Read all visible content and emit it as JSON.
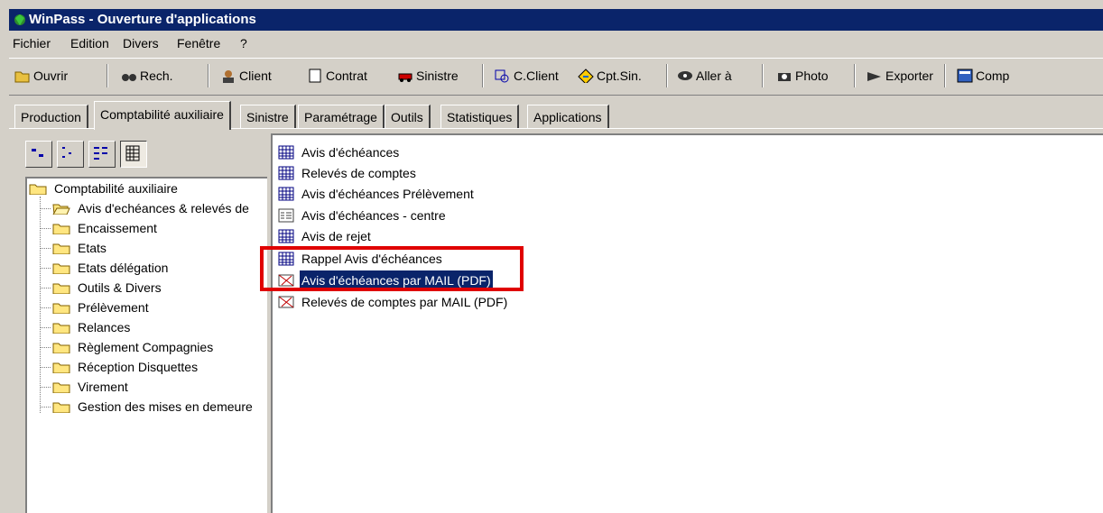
{
  "window": {
    "title": "WinPass - Ouverture d'applications"
  },
  "menu": [
    {
      "label": "Fichier"
    },
    {
      "label": "Edition"
    },
    {
      "label": "Divers"
    },
    {
      "label": "Fenêtre"
    },
    {
      "label": "?"
    }
  ],
  "toolbar": {
    "items": [
      {
        "label": "Ouvrir",
        "icon": "folder-open-icon"
      },
      {
        "label": "Rech.",
        "icon": "binoculars-icon"
      },
      {
        "label": "Client",
        "icon": "client-icon"
      },
      {
        "label": "Contrat",
        "icon": "document-icon"
      },
      {
        "label": "Sinistre",
        "icon": "car-crash-icon"
      },
      {
        "label": "C.Client",
        "icon": "search-client-icon"
      },
      {
        "label": "Cpt.Sin.",
        "icon": "warning-sign-icon"
      },
      {
        "label": "Aller à",
        "icon": "eye-icon"
      },
      {
        "label": "Photo",
        "icon": "camera-icon"
      },
      {
        "label": "Exporter",
        "icon": "export-arrow-icon"
      },
      {
        "label": "Comp",
        "icon": "calculator-icon"
      }
    ]
  },
  "tabs": [
    {
      "label": "Production"
    },
    {
      "label": "Comptabilité auxiliaire",
      "active": true
    },
    {
      "label": "Sinistre"
    },
    {
      "label": "Paramétrage"
    },
    {
      "label": "Outils"
    },
    {
      "label": "Statistiques"
    },
    {
      "label": "Applications"
    }
  ],
  "tree": {
    "root": "Comptabilité auxiliaire",
    "children": [
      {
        "label": "Avis d'echéances & relevés de",
        "open": true
      },
      {
        "label": "Encaissement"
      },
      {
        "label": "Etats"
      },
      {
        "label": "Etats délégation"
      },
      {
        "label": "Outils & Divers"
      },
      {
        "label": "Prélèvement"
      },
      {
        "label": "Relances"
      },
      {
        "label": "Règlement Compagnies"
      },
      {
        "label": "Réception Disquettes"
      },
      {
        "label": "Virement"
      },
      {
        "label": "Gestion des mises en demeure"
      }
    ]
  },
  "list": {
    "items": [
      {
        "label": "Avis d'échéances",
        "icon": "grid-report-icon"
      },
      {
        "label": "Relevés de comptes",
        "icon": "grid-report-icon"
      },
      {
        "label": "Avis d'échéances Prélèvement",
        "icon": "grid-report-icon"
      },
      {
        "label": "Avis d'échéances - centre",
        "icon": "form-report-icon"
      },
      {
        "label": "Avis de rejet",
        "icon": "grid-report-icon"
      },
      {
        "label": "Rappel Avis d'échéances",
        "icon": "grid-report-icon"
      },
      {
        "label": "Avis d'échéances par MAIL (PDF)",
        "icon": "mail-pdf-icon",
        "selected": true
      },
      {
        "label": "Relevés de comptes par MAIL (PDF)",
        "icon": "mail-pdf-icon"
      }
    ]
  },
  "colors": {
    "title_bg": "#0a246a",
    "face": "#d4d0c8",
    "highlight": "#e00000",
    "selection": "#0a246a"
  }
}
